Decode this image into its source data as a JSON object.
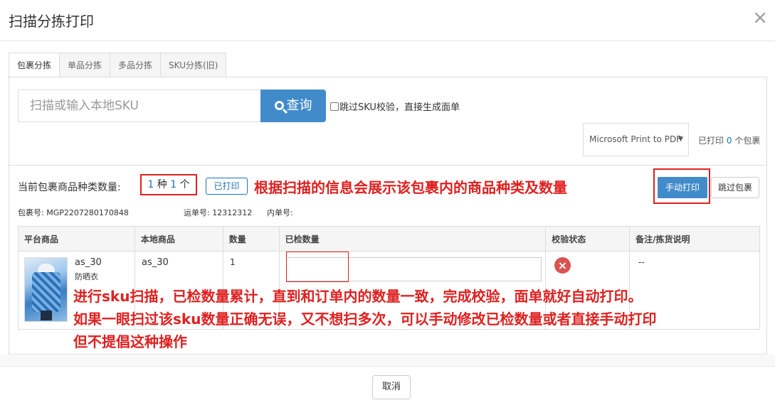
{
  "dialog": {
    "title": "扫描分拣打印",
    "close_label": "×"
  },
  "tabs": [
    {
      "label": "包裹分拣",
      "active": true
    },
    {
      "label": "单品分拣",
      "active": false
    },
    {
      "label": "多品分拣",
      "active": false
    },
    {
      "label": "SKU分拣(旧)",
      "active": false
    }
  ],
  "search": {
    "placeholder": "扫描或输入本地SKU",
    "button_label": "查询",
    "skip_check_label": "跳过SKU校验，直接生成面单"
  },
  "printer": {
    "selected": "Microsoft Print to PDF",
    "printed_prefix": "已打印",
    "printed_count": "0",
    "printed_suffix": "个包裹"
  },
  "package": {
    "count_label": "当前包裹商品种类数量:",
    "kinds": "1",
    "kinds_unit": "种",
    "qty": "1",
    "qty_unit": "个",
    "printed_badge": "已打印",
    "package_no_label": "包裹号:",
    "package_no": "MGP2207280170848",
    "tracking_no_label": "运单号:",
    "tracking_no": "12312312",
    "inner_no_label": "内单号:",
    "inner_no": ""
  },
  "actions": {
    "manual_print": "手动打印",
    "skip_package": "跳过包裹"
  },
  "table": {
    "headers": [
      "平台商品",
      "本地商品",
      "数量",
      "已检数量",
      "校验状态",
      "备注/拣货说明"
    ],
    "rows": [
      {
        "platform_name": "as_30",
        "platform_sub": "防晒衣",
        "local_sku": "as_30",
        "qty": "1",
        "checked_qty": "",
        "status_icon": "×",
        "remark": "--"
      }
    ]
  },
  "annotations": {
    "note_1": "根据扫描的信息会展示该包裹内的商品种类及数量",
    "note_2_line1": "进行sku扫描，已检数量累计，直到和订单内的数量一致，完成校验，面单就好自动打印。",
    "note_2_line2": "如果一眼扫过该sku数量正确无误，又不想扫多次，可以手动修改已检数量或者直接手动打印",
    "note_2_line3": "但不提倡这种操作"
  },
  "footer": {
    "cancel_label": "取消"
  },
  "colors": {
    "primary": "#428bca",
    "annotation_red": "#e02020",
    "link_blue": "#1e73be",
    "error_red": "#d9534f"
  }
}
